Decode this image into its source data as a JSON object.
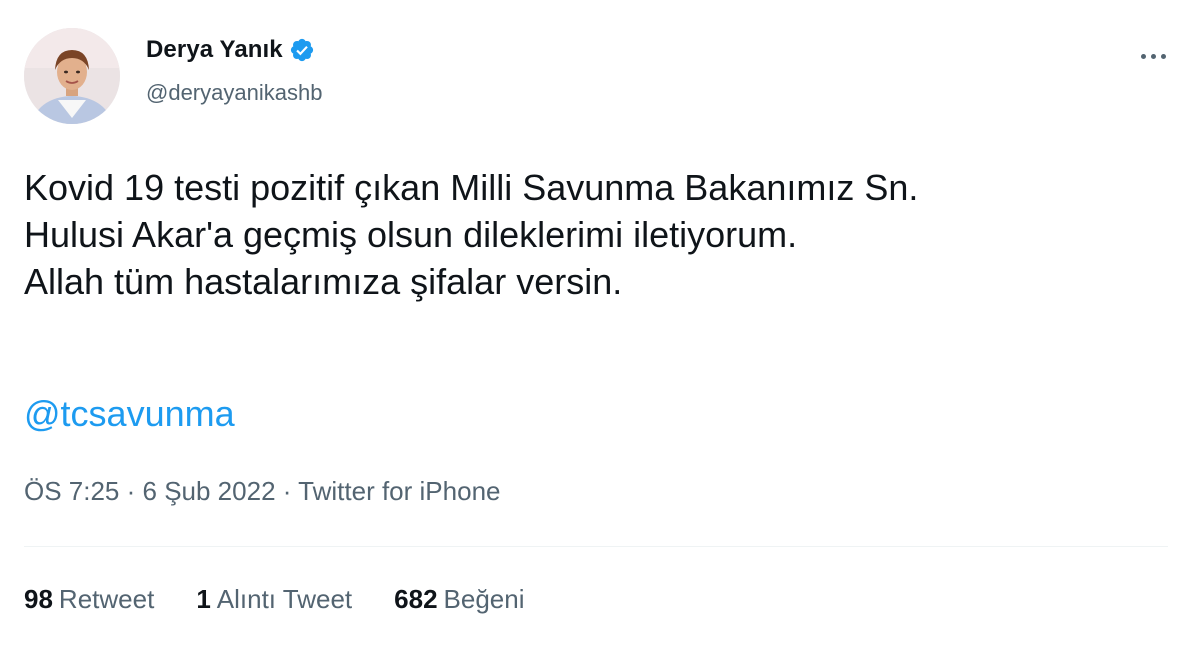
{
  "author": {
    "display_name": "Derya Yanık",
    "handle": "@deryayanikashb",
    "verified_icon": "verified-badge-icon"
  },
  "tweet": {
    "text": "Kovid 19 testi pozitif çıkan Milli Savunma Bakanımız Sn.\nHulusi Akar'a geçmiş olsun dileklerimi iletiyorum.\nAllah tüm hastalarımıza şifalar versin.",
    "mention": "@tcsavunma"
  },
  "meta": {
    "time": "ÖS 7:25",
    "separator": " · ",
    "date": "6 Şub 2022",
    "source": "Twitter for iPhone"
  },
  "stats": {
    "retweets": {
      "count": "98",
      "label": "Retweet"
    },
    "quotes": {
      "count": "1",
      "label": "Alıntı Tweet"
    },
    "likes": {
      "count": "682",
      "label": "Beğeni"
    }
  },
  "colors": {
    "link": "#1d9bf0",
    "secondary": "#536471",
    "primary": "#0f1419",
    "divider": "#eff3f4"
  }
}
